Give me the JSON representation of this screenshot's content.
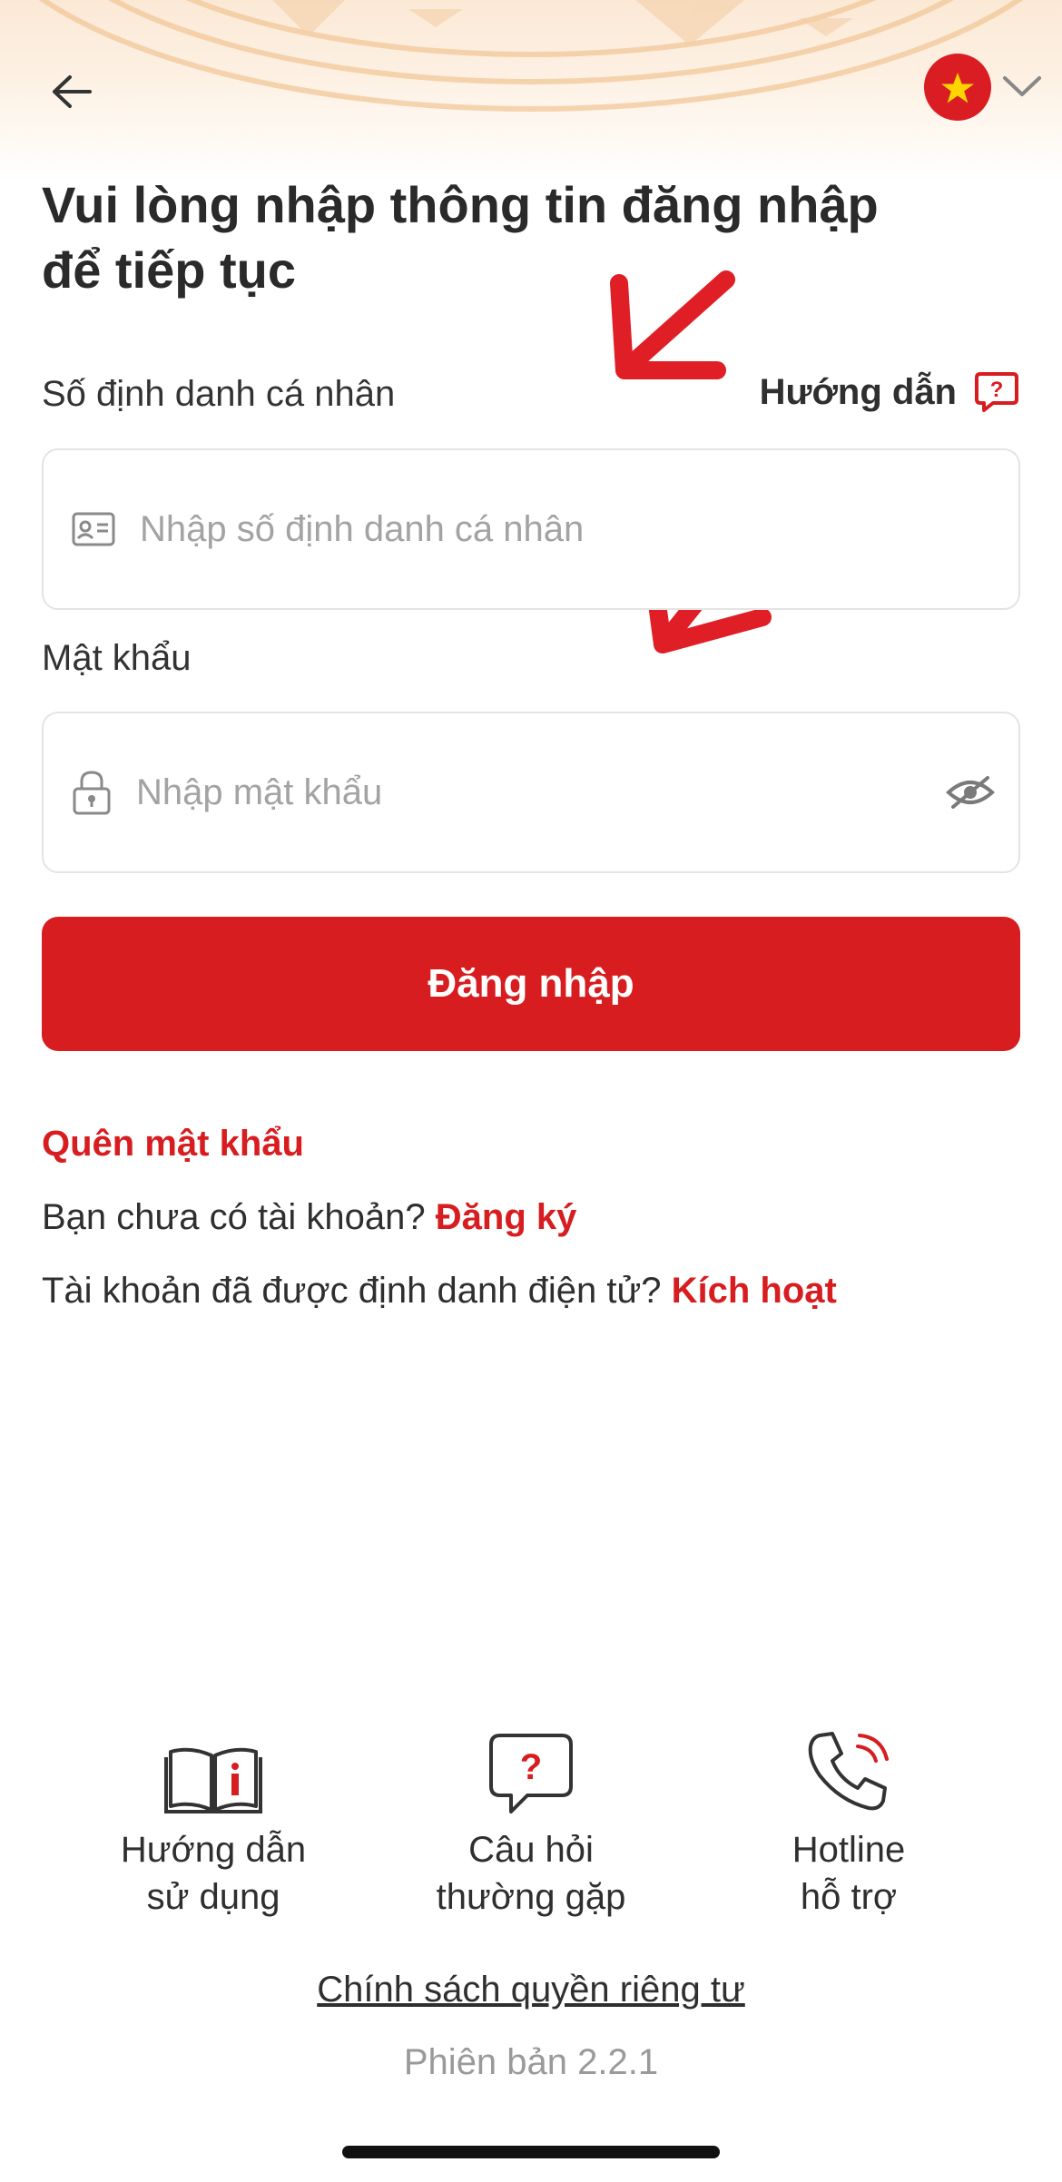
{
  "header": {
    "back_icon": "arrow-left-icon",
    "language": {
      "flag": "vietnam-flag-icon",
      "chevron": "chevron-down-icon"
    }
  },
  "title": {
    "line1": "Vui lòng nhập thông tin đăng nhập",
    "line2": "để tiếp tục"
  },
  "form": {
    "id_label": "Số định danh cá nhân",
    "help_label": "Hướng dẫn",
    "id_placeholder": "Nhập số định danh cá nhân",
    "id_value": "",
    "password_label": "Mật khẩu",
    "password_placeholder": "Nhập mật khẩu",
    "password_value": "",
    "login_button": "Đăng nhập"
  },
  "links": {
    "forgot_password": "Quên mật khẩu",
    "no_account_text": "Bạn chưa có tài khoản?",
    "register": "Đăng ký",
    "activated_text": "Tài khoản đã được định danh điện tử?",
    "activate": "Kích hoạt"
  },
  "footer": {
    "items": [
      {
        "line1": "Hướng dẫn",
        "line2": "sử dụng",
        "icon": "book-info-icon"
      },
      {
        "line1": "Câu hỏi",
        "line2": "thường gặp",
        "icon": "question-bubble-icon"
      },
      {
        "line1": "Hotline",
        "line2": "hỗ trợ",
        "icon": "phone-icon"
      }
    ],
    "privacy": "Chính sách quyền riêng tư",
    "version": "Phiên bản 2.2.1"
  },
  "colors": {
    "brand_red": "#d71d20",
    "text": "#2b2b2b",
    "placeholder": "#a3a3a3"
  }
}
